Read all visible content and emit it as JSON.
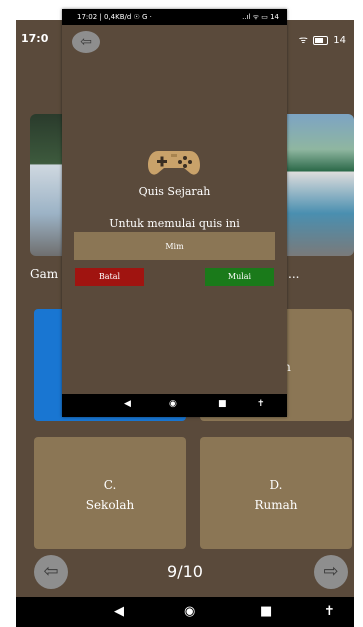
{
  "background_screen": {
    "status_time": "17:0",
    "status_icons": "ᯤ ",
    "battery": "14",
    "caption_left": "Gam",
    "caption_right": "...",
    "options": {
      "b_text": "an",
      "c_letter": "C.",
      "c_text": "Sekolah",
      "d_letter": "D.",
      "d_text": "Rumah"
    },
    "progress": "9/10",
    "prev_glyph": "⇦",
    "next_glyph": "⇨"
  },
  "navigation": {
    "back": "◀",
    "home": "◉",
    "recents": "■",
    "accessibility": "✝"
  },
  "dialog": {
    "status_left": "17:02 | 0,4KB/d ☉ G ·",
    "status_right": "..ıl ᯤ ▭ 14",
    "back_glyph": "⇦",
    "title": "Quis Sejarah",
    "subtitle": "Untuk memulai quis ini",
    "name_value": "Mim",
    "cancel_label": "Batal",
    "start_label": "Mulai"
  },
  "colors": {
    "background": "#5a4a3b",
    "option_tile": "#8b7655",
    "selected_option": "#1976d2",
    "cancel": "#a01410",
    "start": "#1a7a1a",
    "gamepad": "#c9a26a"
  },
  "icons": {
    "dialog_icon": "gamepad-icon"
  }
}
